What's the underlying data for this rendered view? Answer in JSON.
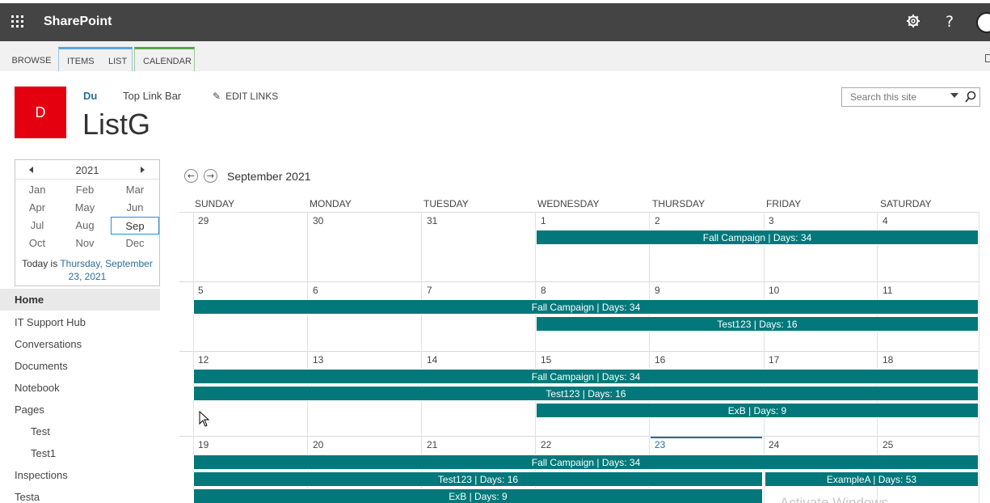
{
  "suitebar": {
    "brand": "SharePoint",
    "icons": [
      "waffle-icon",
      "gear-icon",
      "help-icon",
      "avatar"
    ],
    "help_glyph": "?"
  },
  "ribbon": {
    "tabs": [
      "BROWSE",
      "ITEMS",
      "LIST",
      "CALENDAR"
    ]
  },
  "header": {
    "logo_letter": "D",
    "top_links": [
      "Du",
      "Top Link Bar"
    ],
    "edit_links": "EDIT LINKS",
    "site_title": "ListG"
  },
  "search": {
    "placeholder": "Search this site"
  },
  "date_picker": {
    "year": "2021",
    "months": [
      "Jan",
      "Feb",
      "Mar",
      "Apr",
      "May",
      "Jun",
      "Jul",
      "Aug",
      "Sep",
      "Oct",
      "Nov",
      "Dec"
    ],
    "selected_month": "Sep",
    "today_prefix": "Today is ",
    "today_link_line1": "Thursday, September",
    "today_link_line2": "23, 2021"
  },
  "left_nav": [
    {
      "label": "Home",
      "selected": true
    },
    {
      "label": "IT Support Hub"
    },
    {
      "label": "Conversations"
    },
    {
      "label": "Documents"
    },
    {
      "label": "Notebook"
    },
    {
      "label": "Pages"
    },
    {
      "label": "Test",
      "sub": true
    },
    {
      "label": "Test1",
      "sub": true
    },
    {
      "label": "Inspections"
    },
    {
      "label": "Testa"
    }
  ],
  "calendar": {
    "month_label": "September 2021",
    "day_headers": [
      "SUNDAY",
      "MONDAY",
      "TUESDAY",
      "WEDNESDAY",
      "THURSDAY",
      "FRIDAY",
      "SATURDAY"
    ],
    "weeks": [
      [
        "29",
        "30",
        "31",
        "1",
        "2",
        "3",
        "4"
      ],
      [
        "5",
        "6",
        "7",
        "8",
        "9",
        "10",
        "11"
      ],
      [
        "12",
        "13",
        "14",
        "15",
        "16",
        "17",
        "18"
      ],
      [
        "19",
        "20",
        "21",
        "22",
        "23",
        "24",
        "25"
      ]
    ],
    "today": "23",
    "events": {
      "fall": "Fall Campaign | Days: 34",
      "test123": "Test123 | Days: 16",
      "exb": "ExB | Days: 9",
      "examplea": "ExampleA | Days: 53"
    },
    "accent_color": "#02787a"
  },
  "watermark": "Activate Windows"
}
